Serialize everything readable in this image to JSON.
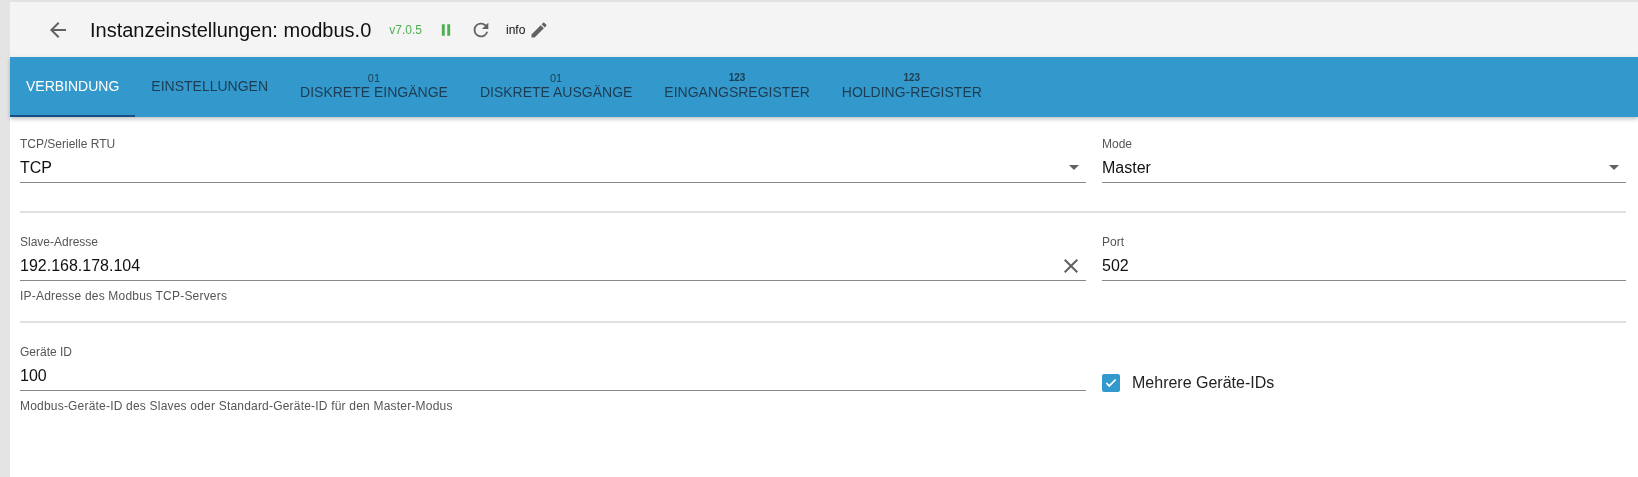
{
  "header": {
    "title": "Instanzeinstellungen: modbus.0",
    "version": "v7.0.5",
    "info_label": "info"
  },
  "tabs": [
    {
      "label": "VERBINDUNG",
      "selected": true
    },
    {
      "label": "EINSTELLUNGEN",
      "selected": false
    },
    {
      "badge": "01",
      "label": "DISKRETE EINGÄNGE",
      "selected": false
    },
    {
      "badge": "01",
      "label": "DISKRETE AUSGÄNGE",
      "selected": false
    },
    {
      "badge": "123",
      "label": "EINGANGSREGISTER",
      "selected": false
    },
    {
      "badge": "123",
      "label": "HOLDING-REGISTER",
      "selected": false
    }
  ],
  "rows": [
    {
      "fields": [
        {
          "kind": "select",
          "label": "TCP/Serielle RTU",
          "value": "TCP"
        },
        {
          "kind": "select",
          "label": "Mode",
          "value": "Master"
        }
      ]
    },
    {
      "fields": [
        {
          "kind": "text",
          "label": "Slave-Adresse",
          "value": "192.168.178.104",
          "helper": "IP-Adresse des Modbus TCP-Servers",
          "clearable": true
        },
        {
          "kind": "text",
          "label": "Port",
          "value": "502"
        }
      ]
    },
    {
      "fields": [
        {
          "kind": "text",
          "label": "Geräte ID",
          "value": "100",
          "helper": "Modbus-Geräte-ID des Slaves oder Standard-Geräte-ID für den Master-Modus"
        },
        {
          "kind": "checkbox",
          "label": "Mehrere Geräte-IDs",
          "checked": true
        }
      ]
    }
  ]
}
